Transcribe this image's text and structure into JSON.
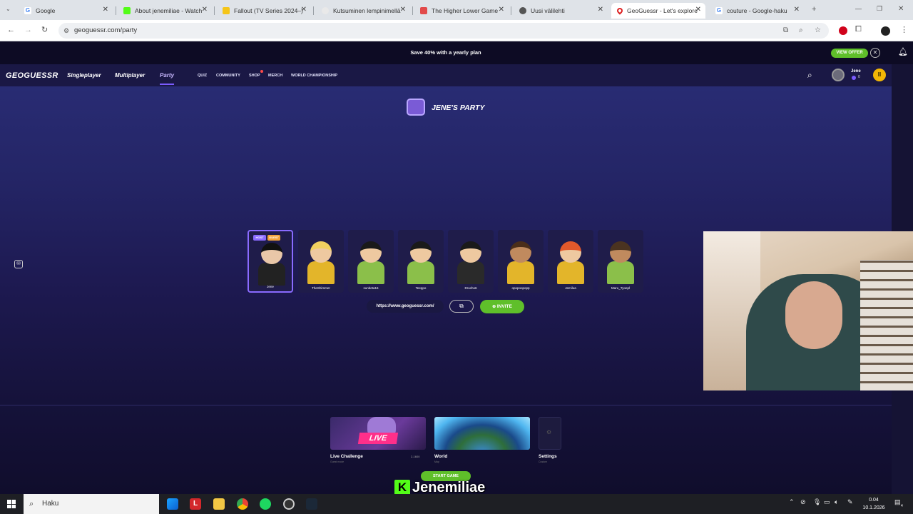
{
  "browser": {
    "tabs": [
      {
        "title": "Google",
        "active": false
      },
      {
        "title": "About jenemiliae - Watch",
        "active": false
      },
      {
        "title": "Fallout (TV Series 2024–)",
        "active": false
      },
      {
        "title": "Kutsuminen lempinimellä",
        "active": false
      },
      {
        "title": "The Higher Lower Game",
        "active": false
      },
      {
        "title": "Uusi välilehti",
        "active": false
      },
      {
        "title": "GeoGuessr - Let's explore",
        "active": true
      },
      {
        "title": "couture - Google-haku",
        "active": false
      }
    ],
    "url": "geoguessr.com/party"
  },
  "promo": {
    "text": "Save 40% with a yearly plan",
    "button": "VIEW OFFER"
  },
  "nav": {
    "logo": "GEOGUESSR",
    "main": [
      "Singleplayer",
      "Multiplayer",
      "Party"
    ],
    "secondary": [
      "QUIZ",
      "COMMUNITY",
      "SHOP",
      "MERCH",
      "WORLD CHAMPIONSHIP"
    ],
    "user": {
      "name": "Jene",
      "level": "0"
    }
  },
  "party": {
    "title": "JENE'S PARTY",
    "host_tags": [
      "HOST",
      "GUEST"
    ],
    "members": [
      "Jene",
      "TheShimmer",
      "sunbeta16",
      "Teeppo",
      "Drucho6",
      "opopoopopp",
      "Jemilua",
      "Maru_Tyoepl"
    ],
    "invite_link": "https://www.geoguessr.com/",
    "invite_button": "INVITE"
  },
  "modes": [
    {
      "label": "Live Challenge",
      "sub": "Guest mode",
      "extra": "2-1600"
    },
    {
      "label": "World",
      "sub": "Map"
    },
    {
      "label": "Settings",
      "sub": "Custom"
    }
  ],
  "live_badge": "LIVE",
  "start_button": "START GAME",
  "stream": {
    "platform_letter": "K",
    "channel": "Jenemiliae"
  },
  "taskbar": {
    "search_placeholder": "Haku",
    "time": "0.04",
    "date": "10.1.2026",
    "notif_count": "4"
  }
}
